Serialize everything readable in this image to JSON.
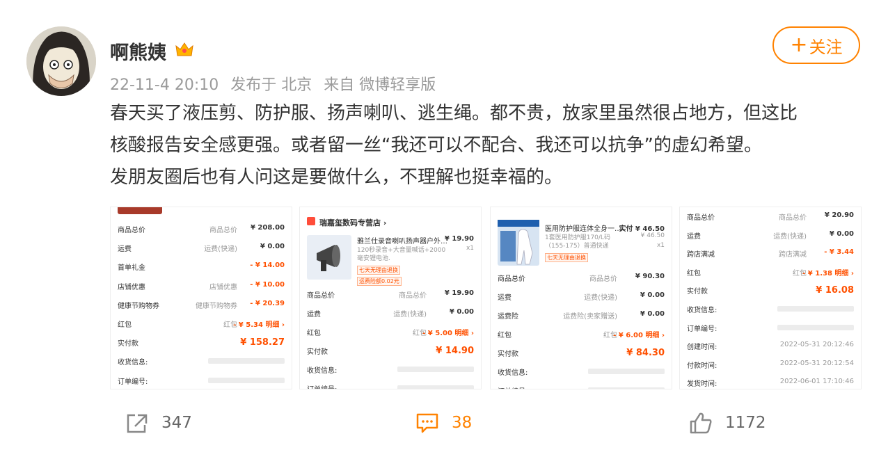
{
  "user": {
    "name": "啊熊姨"
  },
  "meta": {
    "time": "22-11-4 20:10",
    "location": "发布于 北京",
    "source": "来自 微博轻享版"
  },
  "follow": {
    "label": "关注",
    "plus": "+"
  },
  "content": {
    "line1": "春天买了液压剪、防护服、扬声喇叭、逃生绳。都不贵，放家里虽然很占地方，但这比",
    "line2": "核酸报告安全感更强。或者留一丝“我还可以不配合、我还可以抗争”的虚幻希望。",
    "line3": "发朋友圈后也有人问这是要做什么，不理解也挺幸福的。"
  },
  "images": {
    "img1": {
      "rows": [
        {
          "k": "商品总价",
          "m": "商品总价",
          "v": "¥ 208.00"
        },
        {
          "k": "运费",
          "m": "运费(快递)",
          "v": "¥ 0.00"
        },
        {
          "k": "首单礼金",
          "m": "",
          "v": "- ¥ 14.00"
        },
        {
          "k": "店铺优惠",
          "m": "店铺优惠",
          "v": "- ¥ 10.00"
        },
        {
          "k": "健康节购物券",
          "m": "健康节购物券",
          "v": "- ¥ 20.39"
        },
        {
          "k": "红包",
          "m": "红包",
          "v": "- ¥ 5.34 明细 ›"
        },
        {
          "k": "实付款",
          "m": "",
          "v": "¥ 158.27"
        },
        {
          "k": "收货信息:",
          "m": "",
          "v": ""
        },
        {
          "k": "订单编号:",
          "m": "",
          "v": ""
        }
      ]
    },
    "img2": {
      "store": "瑞嘉玺数码专营店 ›",
      "product": "雅兰仕录音喇叭扬声器户外…",
      "desc": "120秒录音+大音量喊话+2000毫安锂电池.",
      "price": "¥ 19.90",
      "qty": "x1",
      "tag1": "七天无理由退换",
      "tag2": "运费险额0.02元",
      "rows": [
        {
          "k": "商品总价",
          "m": "商品总价",
          "v": "¥ 19.90"
        },
        {
          "k": "运费",
          "m": "运费(快递)",
          "v": "¥ 0.00"
        },
        {
          "k": "红包",
          "m": "红包",
          "v": "- ¥ 5.00 明细 ›"
        },
        {
          "k": "实付款",
          "m": "",
          "v": "¥ 14.90"
        },
        {
          "k": "收货信息:",
          "m": "",
          "v": ""
        },
        {
          "k": "订单编号:",
          "m": "",
          "v": ""
        }
      ]
    },
    "img3": {
      "product": "医用防护服连体全身一…",
      "price": "实付 ¥ 46.50",
      "orig": "¥ 46.50",
      "qty": "x1",
      "desc": "1套医用防护服170/L码（155-175）普通快递",
      "tag1": "七天无理由退换",
      "rows": [
        {
          "k": "商品总价",
          "m": "商品总价",
          "v": "¥ 90.30"
        },
        {
          "k": "运费",
          "m": "运费(快递)",
          "v": "¥ 0.00"
        },
        {
          "k": "运费险",
          "m": "运费险(卖家赠送)",
          "v": "¥ 0.00"
        },
        {
          "k": "红包",
          "m": "红包",
          "v": "- ¥ 6.00 明细 ›"
        },
        {
          "k": "实付款",
          "m": "",
          "v": "¥ 84.30"
        },
        {
          "k": "收货信息:",
          "m": "",
          "v": ""
        },
        {
          "k": "订单编号:",
          "m": "",
          "v": ""
        }
      ]
    },
    "img4": {
      "rows": [
        {
          "k": "商品总价",
          "m": "商品总价",
          "v": "¥ 20.90"
        },
        {
          "k": "运费",
          "m": "运费(快递)",
          "v": "¥ 0.00"
        },
        {
          "k": "跨店满减",
          "m": "跨店满减",
          "v": "- ¥ 3.44"
        },
        {
          "k": "红包",
          "m": "红包",
          "v": "- ¥ 1.38 明细 ›"
        },
        {
          "k": "实付款",
          "m": "",
          "v": "¥ 16.08"
        },
        {
          "k": "收货信息:",
          "m": "",
          "v": ""
        },
        {
          "k": "订单编号:",
          "m": "",
          "v": ""
        },
        {
          "k": "创建时间:",
          "m": "",
          "v": "2022-05-31 20:12:46"
        },
        {
          "k": "付款时间:",
          "m": "",
          "v": "2022-05-31 20:12:54"
        },
        {
          "k": "发货时间:",
          "m": "",
          "v": "2022-06-01 17:10:46"
        }
      ]
    }
  },
  "actions": {
    "repost": "347",
    "comment": "38",
    "like": "1172"
  },
  "colors": {
    "accent": "#ff8200",
    "price": "#ff5000"
  }
}
